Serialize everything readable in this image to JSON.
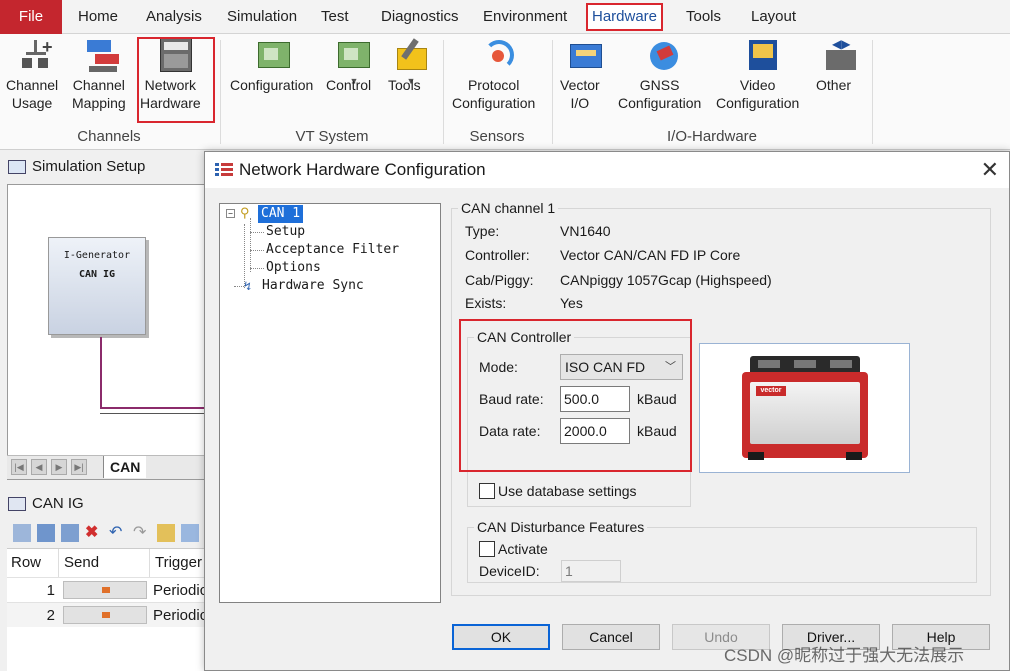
{
  "ribbon_tabs": [
    {
      "label": "File"
    },
    {
      "label": "Home"
    },
    {
      "label": "Analysis"
    },
    {
      "label": "Simulation"
    },
    {
      "label": "Test"
    },
    {
      "label": "Diagnostics"
    },
    {
      "label": "Environment"
    },
    {
      "label": "Hardware"
    },
    {
      "label": "Tools"
    },
    {
      "label": "Layout"
    }
  ],
  "active_tab": "Hardware",
  "ribbon": {
    "channels": {
      "group_label": "Channels",
      "channel_usage": "Channel\nUsage",
      "channel_mapping": "Channel\nMapping",
      "network_hardware": "Network\nHardware"
    },
    "vt_system": {
      "group_label": "VT System",
      "configuration": "Configuration",
      "control": "Control",
      "tools": "Tools"
    },
    "sensors": {
      "group_label": "Sensors",
      "protocol_configuration": "Protocol\nConfiguration"
    },
    "io_hardware": {
      "group_label": "I/O-Hardware",
      "vector_io": "Vector\nI/O",
      "gnss_configuration": "GNSS\nConfiguration",
      "video_configuration": "Video\nConfiguration",
      "other": "Other"
    }
  },
  "simulation_setup": {
    "title": "Simulation Setup",
    "node_line1": "I-Generator",
    "node_line2": "CAN IG",
    "bus_tab": "CAN"
  },
  "can_ig": {
    "title": "CAN IG",
    "columns": [
      "Row",
      "Send",
      "Trigger"
    ],
    "rows": [
      {
        "row": "1",
        "trigger": "Periodic"
      },
      {
        "row": "2",
        "trigger": "Periodic"
      }
    ]
  },
  "dialog": {
    "title": "Network Hardware Configuration",
    "close": "✕",
    "tree": {
      "root": "CAN 1",
      "children": [
        "Setup",
        "Acceptance Filter",
        "Options"
      ],
      "sibling": "Hardware Sync"
    },
    "channel_group": {
      "legend": "CAN channel 1",
      "fields": [
        {
          "label": "Type:",
          "value": "VN1640"
        },
        {
          "label": "Controller:",
          "value": "Vector CAN/CAN FD IP Core"
        },
        {
          "label": "Cab/Piggy:",
          "value": "CANpiggy 1057Gcap (Highspeed)"
        },
        {
          "label": "Exists:",
          "value": "Yes"
        }
      ]
    },
    "controller": {
      "legend": "CAN Controller",
      "mode_label": "Mode:",
      "mode_value": "ISO CAN FD",
      "baud_label": "Baud rate:",
      "baud_value": "500.0",
      "baud_unit": "kBaud",
      "data_label": "Data rate:",
      "data_value": "2000.0",
      "data_unit": "kBaud"
    },
    "use_database": "Use database settings",
    "device_logo": "vector",
    "disturbance": {
      "legend": "CAN Disturbance Features",
      "activate": "Activate",
      "device_id_label": "DeviceID:",
      "device_id_value": "1"
    },
    "buttons": {
      "ok": "OK",
      "cancel": "Cancel",
      "undo": "Undo",
      "driver": "Driver...",
      "help": "Help"
    }
  },
  "watermark": "CSDN @昵称过于强大无法展示",
  "colors": {
    "accent_red": "#d9262e",
    "selection_blue": "#1e6fd9",
    "file_tab": "#c4262e"
  }
}
